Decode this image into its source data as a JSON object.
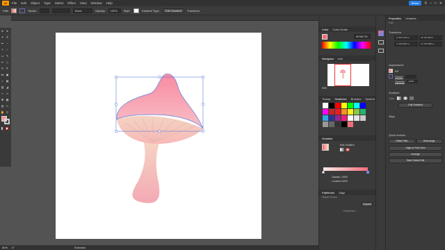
{
  "menu": {
    "logo": "Ai",
    "items": [
      "File",
      "Edit",
      "Object",
      "Type",
      "Select",
      "Effect",
      "View",
      "Window",
      "Help"
    ],
    "share": "Share"
  },
  "control": {
    "object_type": "Path",
    "stroke_label": "Stroke:",
    "brush": "Basic",
    "opacity_label": "Opacity:",
    "opacity_value": "100%",
    "style_label": "Style:",
    "gradient_type_label": "Gradient Type:",
    "edit_gradient": "Edit Gradient",
    "transform_label": "Transform"
  },
  "status": {
    "zoom": "50%",
    "angle": "0°",
    "tool": "Selection"
  },
  "color_panel": {
    "tabs": [
      "Color",
      "Color Guide"
    ],
    "hex": "F06C78"
  },
  "navigator": {
    "tabs": [
      "Navigator",
      "Info"
    ],
    "zoom": "50%"
  },
  "swatches": {
    "tabs": [
      "Transp",
      "Swatches",
      "Brushes",
      "Symbol"
    ],
    "colors": [
      "#ffffff",
      "#000000",
      "#ff0000",
      "#ffff00",
      "#00ff00",
      "#00ffff",
      "#0000ff",
      "#ff00ff",
      "#c1272d",
      "#ed1c24",
      "#f7931e",
      "#fcee21",
      "#8cc63f",
      "#22b573",
      "#29abe2",
      "#2e3192",
      "#93278f",
      "#ed1e79",
      "#ffffff",
      "#e6e6e6",
      "#cccccc",
      "#999999",
      "#666666",
      "#333333",
      "#000000",
      "#f06c78"
    ]
  },
  "gradient_panel": {
    "title": "Gradient",
    "edit_gradient": "Edit Gradient",
    "opacity_label": "Opacity:",
    "opacity_value": "100%",
    "location_label": "Location:",
    "location_value": "100%"
  },
  "pathfinder": {
    "tabs": [
      "Pathfinder",
      "Align"
    ],
    "shape_modes": "Shape Modes:",
    "expand": "Expand",
    "pathfinders": "Pathfinders:"
  },
  "properties": {
    "tabs": [
      "Properties",
      "Libraries"
    ],
    "path_label": "Path",
    "transform": "Transform",
    "x": "X: 504.7321 p",
    "y": "Y: 231.6201 p",
    "w": "W: 157.38 pt",
    "h": "H: 176.3621 p",
    "appearance": "Appearance",
    "fill": "Fill",
    "stroke": "Stroke",
    "opacity": "Opacity",
    "opacity_value": "100%",
    "gradient": "Gradient",
    "type": "Type:",
    "edit_gradient": "Edit Gradient",
    "align": "Align",
    "quick_actions": "Quick Actions",
    "offset_path": "Offset Path",
    "rearrange": "Rearrange",
    "align_pixel": "Align to Pixel Grid",
    "arrange": "Arrange",
    "start_global_edit": "Start Global Edit"
  }
}
